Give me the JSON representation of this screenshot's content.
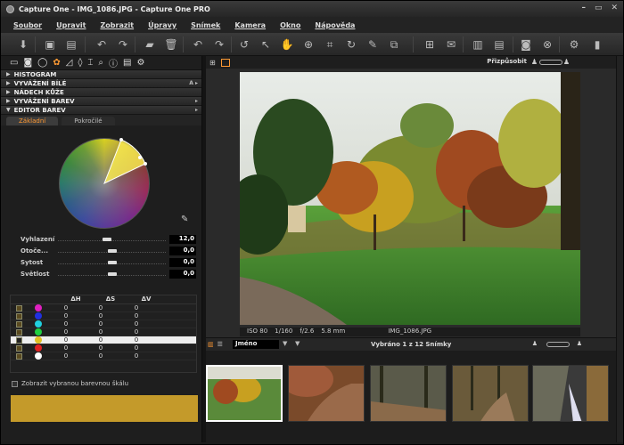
{
  "titlebar": {
    "title": "Capture One - IMG_1086.JPG - Capture One PRO"
  },
  "menu": [
    "Soubor",
    "Upravit",
    "Zobrazit",
    "Úpravy",
    "Snímek",
    "Kamera",
    "Okno",
    "Nápověda"
  ],
  "toolbar": {
    "selected_tool": "hand-tool"
  },
  "sections": [
    {
      "label": "HISTOGRAM",
      "right": ""
    },
    {
      "label": "VYVÁŽENÍ BÍLÉ",
      "right": "A ▸"
    },
    {
      "label": "NÁDECH KŮŽE",
      "right": ""
    },
    {
      "label": "VYVÁŽENÍ BAREV",
      "right": "▸"
    },
    {
      "label": "EDITOR BAREV",
      "right": "▸"
    }
  ],
  "editor": {
    "tabs": [
      "Základní",
      "Pokročilé"
    ],
    "active_tab": "Základní"
  },
  "sliders": [
    {
      "label": "Vyhlazení",
      "value": "12,0",
      "level": 0.45
    },
    {
      "label": "Otoče...",
      "value": "0,0",
      "level": 0.5
    },
    {
      "label": "Sytost",
      "value": "0,0",
      "level": 0.5
    },
    {
      "label": "Světlost",
      "value": "0,0",
      "level": 0.5
    }
  ],
  "color_table": {
    "headers": [
      "ΔH",
      "ΔS",
      "ΔV"
    ],
    "rows": [
      {
        "color": "#e020c0",
        "h": "0",
        "s": "0",
        "v": "0",
        "checked": true
      },
      {
        "color": "#2030e0",
        "h": "0",
        "s": "0",
        "v": "0",
        "checked": true
      },
      {
        "color": "#20d0e0",
        "h": "0",
        "s": "0",
        "v": "0",
        "checked": true
      },
      {
        "color": "#20d040",
        "h": "0",
        "s": "0",
        "v": "0",
        "checked": true
      },
      {
        "color": "#e0c020",
        "h": "0",
        "s": "0",
        "v": "0",
        "checked": false
      },
      {
        "color": "#e02020",
        "h": "0",
        "s": "0",
        "v": "0",
        "checked": true
      },
      {
        "color": "#ffffff",
        "h": "0",
        "s": "0",
        "v": "0",
        "checked": true
      }
    ],
    "selected_row": 4
  },
  "show_scale": {
    "label": "Zobrazit vybranou barevnou škálu"
  },
  "viewer": {
    "fit_label": "Přizpůsobit",
    "iso": "ISO 80",
    "shutter": "1/160",
    "aperture": "f/2.6",
    "focal": "5.8 mm",
    "filename": "IMG_1086.JPG"
  },
  "browser": {
    "sort_label": "Jméno",
    "count_label": "Vybráno 1 z 12 Snímky"
  },
  "colors": {
    "accent": "#ff9933",
    "swatch": "#c49a2a"
  }
}
